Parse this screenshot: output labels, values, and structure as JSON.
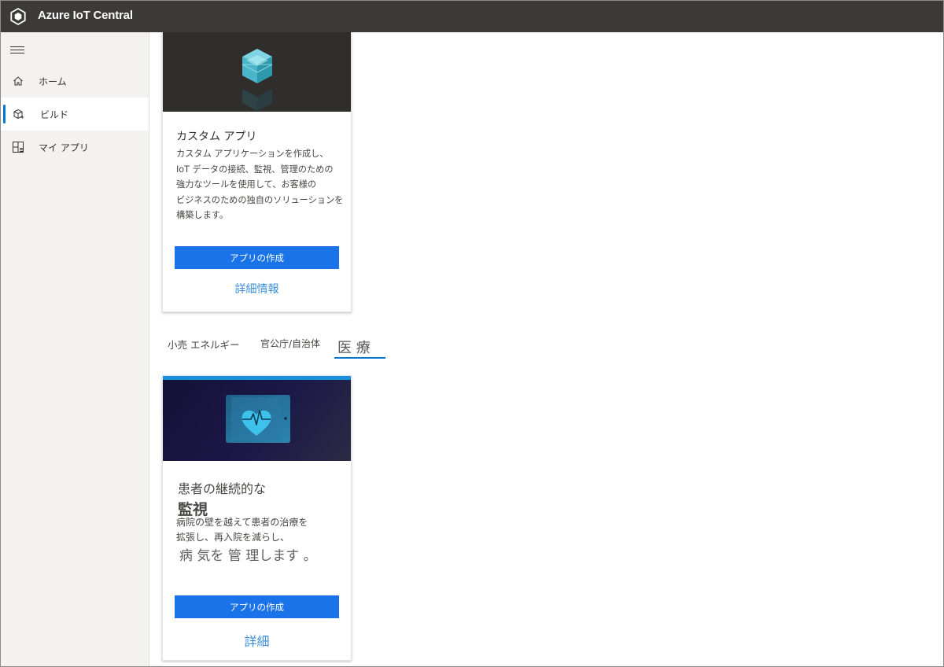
{
  "header": {
    "app_title": "Azure IoT Central"
  },
  "sidebar": {
    "items": [
      {
        "label": "ホーム",
        "icon": "home-icon"
      },
      {
        "label": "ビルド",
        "icon": "build-cube-icon",
        "active": true
      },
      {
        "label": "マイ アプリ",
        "icon": "my-apps-grid-icon"
      }
    ]
  },
  "custom_app_card": {
    "title": "カスタム アプリ",
    "description_lines": [
      "カスタム アプリケーションを作成し、",
      "IoT データの接続、監視、管理のための",
      "強力なツールを使用して、お客様の",
      "ビジネスのための独自のソリューションを",
      "構築します。"
    ],
    "create_button": "アプリの作成",
    "learn_more_link": "詳細情報"
  },
  "industry_tabs": [
    {
      "label": "小売 エネルギー"
    },
    {
      "label": "官公庁/自治体"
    },
    {
      "label": "医 療",
      "active": true
    }
  ],
  "healthcare_card": {
    "title_line1": "患者の継続的な",
    "title_line2": "監視",
    "description_lines": [
      "病院の壁を越えて患者の治療を",
      "拡張し、再入院を減らし、"
    ],
    "description_line3": "病 気を 管 理します 。",
    "create_button": "アプリの作成",
    "learn_more_link": "詳細"
  },
  "colors": {
    "topbar": "#3b3a39",
    "sidebar": "#f3f2f1",
    "primary_button": "#1a73e8",
    "accent": "#0078d4",
    "link": "#3b8ed8"
  }
}
